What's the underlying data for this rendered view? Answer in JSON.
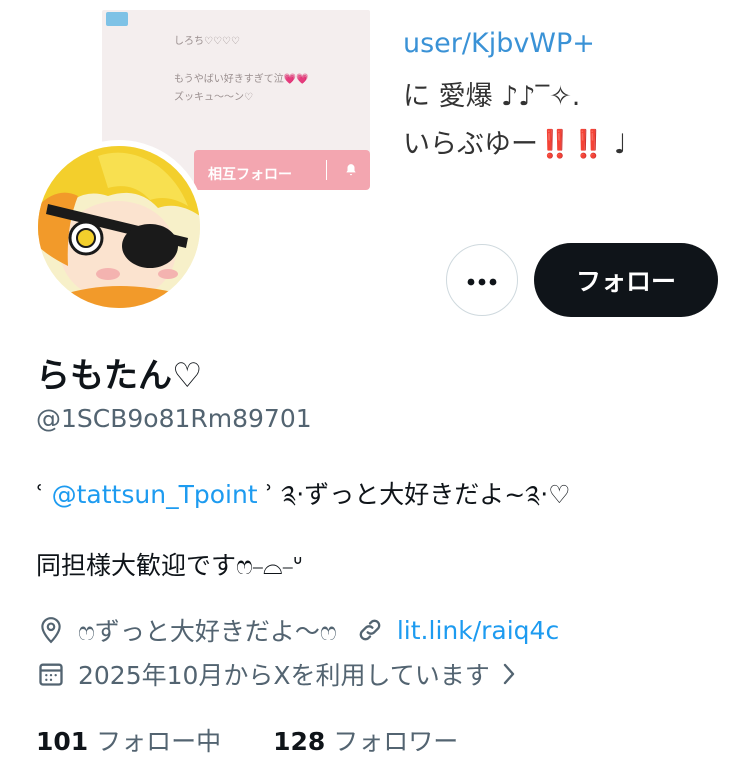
{
  "banner": {
    "card_lines": [
      "しろち♡♡♡♡",
      "もうやばい好きすぎて泣💗💗",
      "ズッキュ〜〜ン♡"
    ],
    "card_follow_label": "相互フォロー",
    "text_lines": [
      "user/KjbvWP+",
      "に 愛爆 ♪♪‾✧.",
      "いらぶゆー‼️‼️ ♩"
    ]
  },
  "profile": {
    "display_name": "らもたん♡",
    "handle": "@1SCB9o81Rm89701",
    "bio_prefix": "ʿ  ",
    "bio_mention": "@tattsun_Tpoint",
    "bio_suffix": "  ʾ  ༉‧ずっと大好きだよ~༉‧♡",
    "bio_line2": "同担様大歓迎ですෆ⎯⌓⎯ᐡ",
    "location": "ෆずっと大好きだよ〜ෆ",
    "link": "lit.link/raiq4c",
    "joined": "2025年10月からXを利用しています"
  },
  "actions": {
    "follow_label": "フォロー"
  },
  "stats": {
    "following_count": "101",
    "following_label": "フォロー中",
    "followers_count": "128",
    "followers_label": "フォロワー"
  },
  "icons": [
    "more-icon",
    "location-icon",
    "link-icon",
    "calendar-icon",
    "chevron-right-icon",
    "bell-icon"
  ],
  "colors": {
    "link": "#1d9bf0",
    "follow_button_bg": "#0f1419",
    "secondary_text": "#536471"
  }
}
